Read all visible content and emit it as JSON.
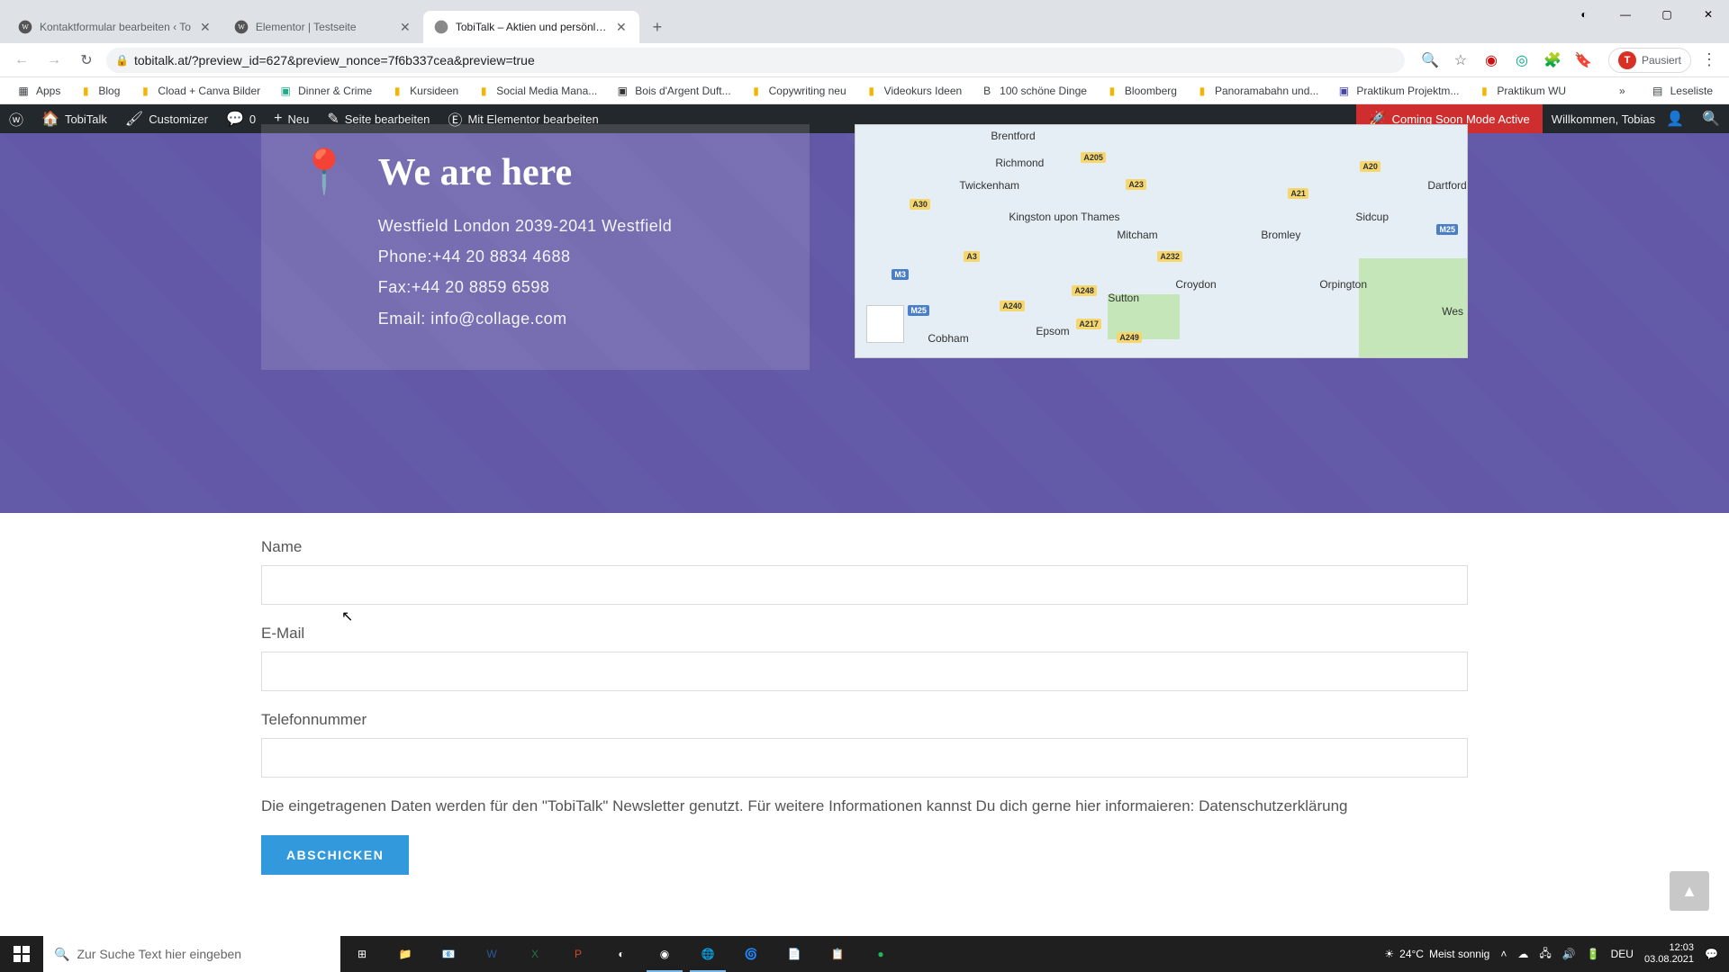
{
  "chrome": {
    "tabs": [
      {
        "title": "Kontaktformular bearbeiten ‹ To",
        "active": false
      },
      {
        "title": "Elementor | Testseite",
        "active": false
      },
      {
        "title": "TobiTalk – Aktien und persönlich",
        "active": true
      }
    ],
    "url": "tobitalk.at/?preview_id=627&preview_nonce=7f6b337cea&preview=true",
    "profile_label": "Pausiert",
    "profile_letter": "T",
    "bookmarks": [
      "Apps",
      "Blog",
      "Cload + Canva Bilder",
      "Dinner & Crime",
      "Kursideen",
      "Social Media Mana...",
      "Bois d'Argent Duft...",
      "Copywriting neu",
      "Videokurs Ideen",
      "100 schöne Dinge",
      "Bloomberg",
      "Panoramabahn und...",
      "Praktikum Projektm...",
      "Praktikum WU"
    ],
    "reading_list": "Leseliste"
  },
  "wpbar": {
    "site": "TobiTalk",
    "customizer": "Customizer",
    "comments": "0",
    "new": "Neu",
    "edit": "Seite bearbeiten",
    "elementor": "Mit Elementor bearbeiten",
    "comingsoon": "Coming Soon Mode Active",
    "welcome": "Willkommen, Tobias"
  },
  "hero": {
    "heading": "We are here",
    "address": "Westfield London 2039-2041 Westfield",
    "phone": "Phone:+44 20 8834 4688",
    "fax": "Fax:+44 20 8859 6598",
    "email": "Email: info@collage.com",
    "map_labels": [
      "Brentford",
      "Richmond",
      "Twickenham",
      "Kingston upon Thames",
      "Mitcham",
      "Croydon",
      "Sutton",
      "Epsom",
      "Cobham",
      "Bromley",
      "Orpington",
      "Dartford",
      "Sidcup",
      "Wes"
    ],
    "map_roads": [
      "A205",
      "A30",
      "A3",
      "M3",
      "A240",
      "A217",
      "A232",
      "A23",
      "A21",
      "A20",
      "M25",
      "A248",
      "A249",
      "M25"
    ]
  },
  "form": {
    "name_label": "Name",
    "email_label": "E-Mail",
    "phone_label": "Telefonnummer",
    "disclaimer": "Die eingetragenen Daten werden für den \"TobiTalk\" Newsletter genutzt. Für weitere Informationen kannst Du dich gerne hier informaieren: Datenschutzerklärung",
    "submit": "Abschicken"
  },
  "taskbar": {
    "search_placeholder": "Zur Suche Text hier eingeben",
    "weather_temp": "24°C",
    "weather_text": "Meist sonnig",
    "lang": "DEU",
    "time": "12:03",
    "date": "03.08.2021"
  }
}
